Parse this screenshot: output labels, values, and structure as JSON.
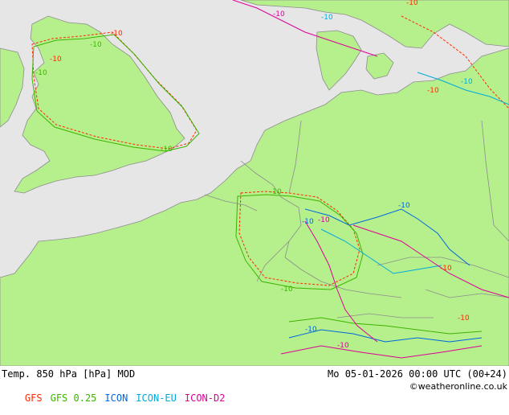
{
  "title": "Temp. 850 hPa [hPa] MOD",
  "valid_time": "Mo 05-01-2026 00:00 UTC (00+24)",
  "credit": "©weatheronline.co.uk",
  "models": [
    {
      "name": "GFS",
      "color": "#ff2a00"
    },
    {
      "name": "GFS 0.25",
      "color": "#3cb400"
    },
    {
      "name": "ICON",
      "color": "#0066dd"
    },
    {
      "name": "ICON-EU",
      "color": "#00aadd"
    },
    {
      "name": "ICON-D2",
      "color": "#dd0099"
    }
  ],
  "colors": {
    "land": "#b6f08c",
    "sea": "#e6e6e6",
    "border": "#8c8c8c",
    "coast": "#8c8c8c"
  },
  "contour_value": "-10"
}
